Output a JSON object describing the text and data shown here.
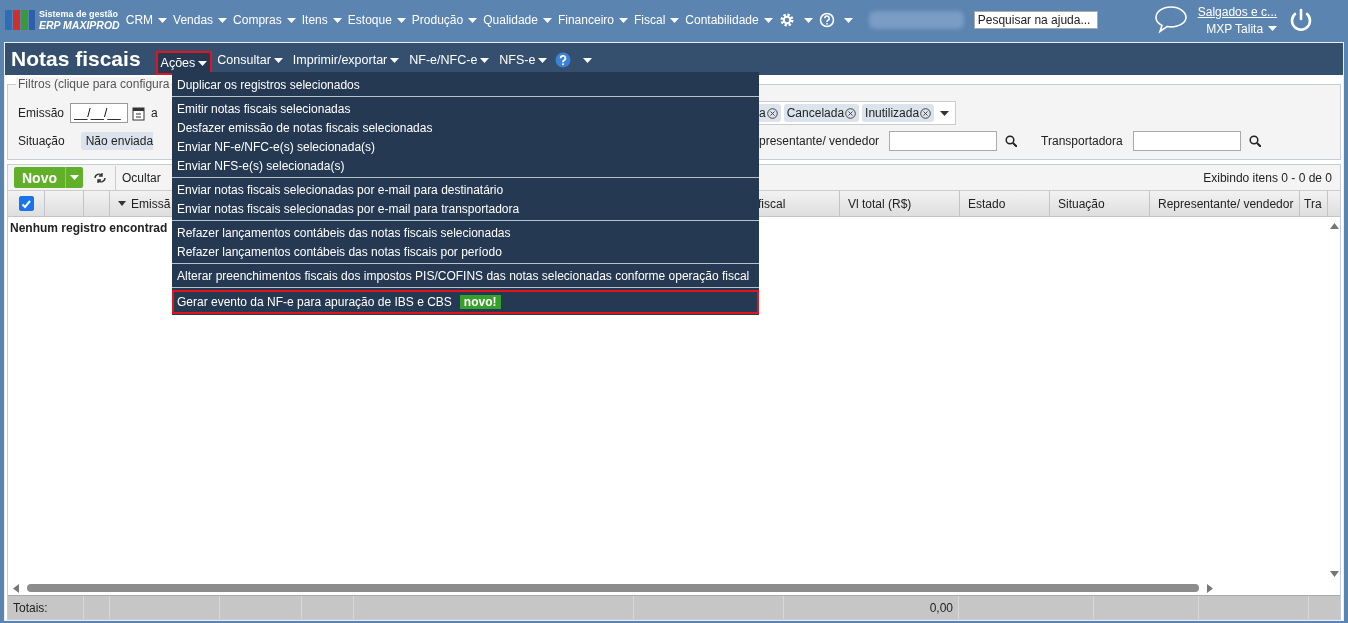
{
  "app": {
    "logo_line1": "Sistema de gestão",
    "logo_line2": "ERP MAXIPROD"
  },
  "nav": [
    {
      "label": "CRM"
    },
    {
      "label": "Vendas"
    },
    {
      "label": "Compras"
    },
    {
      "label": "Itens"
    },
    {
      "label": "Estoque"
    },
    {
      "label": "Produção"
    },
    {
      "label": "Qualidade"
    },
    {
      "label": "Financeiro"
    },
    {
      "label": "Fiscal"
    },
    {
      "label": "Contabilidade"
    }
  ],
  "help_search": {
    "placeholder": "Pesquisar na ajuda..."
  },
  "user": {
    "company": "Salgados e c...",
    "name": "MXP Talita"
  },
  "page": {
    "title": "Notas fiscais",
    "menu": [
      {
        "label": "Ações",
        "expanded": true
      },
      {
        "label": "Consultar",
        "expanded": false
      },
      {
        "label": "Imprimir/exportar",
        "expanded": false
      },
      {
        "label": "NF-e/NFC-e",
        "expanded": false
      },
      {
        "label": "NFS-e",
        "expanded": false
      }
    ]
  },
  "actions_menu": {
    "groups": [
      {
        "items": [
          {
            "label": "Duplicar os registros selecionados",
            "highlighted": false
          }
        ]
      },
      {
        "items": [
          {
            "label": "Emitir notas fiscais selecionadas",
            "highlighted": false
          },
          {
            "label": "Desfazer emissão de notas fiscais selecionadas",
            "highlighted": false
          },
          {
            "label": "Enviar NF-e/NFC-e(s) selecionada(s)",
            "highlighted": false
          },
          {
            "label": "Enviar NFS-e(s) selecionada(s)",
            "highlighted": false
          }
        ]
      },
      {
        "items": [
          {
            "label": "Enviar notas fiscais selecionadas por e-mail para destinatário",
            "highlighted": false
          },
          {
            "label": "Enviar notas fiscais selecionadas por e-mail para transportadora",
            "highlighted": false
          }
        ]
      },
      {
        "items": [
          {
            "label": "Refazer lançamentos contábeis das notas fiscais selecionadas",
            "highlighted": false
          },
          {
            "label": "Refazer lançamentos contábeis das notas fiscais por período",
            "highlighted": false
          }
        ]
      },
      {
        "items": [
          {
            "label": "Alterar preenchimentos fiscais dos impostos PIS/COFINS das notas selecionadas conforme operação fiscal",
            "highlighted": false
          }
        ]
      },
      {
        "items": [
          {
            "label": "Gerar evento da NF-e para apuração de IBS e CBS",
            "highlighted": true,
            "badge": "novo!"
          }
        ]
      }
    ]
  },
  "filters": {
    "legend": "Filtros (clique para configura",
    "emissao_label": "Emissão",
    "date_value": "__/__/__",
    "range_separator": "a",
    "situacao_label": "Situação",
    "situacao_tag": "Não enviada",
    "tags": [
      {
        "label": "a"
      },
      {
        "label": "Cancelada"
      },
      {
        "label": "Inutilizada"
      }
    ],
    "representative_label": "presentante/ vendedor",
    "carrier_label": "Transportadora"
  },
  "toolbar": {
    "new_button": "Novo",
    "hide_button": "Ocultar",
    "range_text": "Exibindo itens 0 - 0 de 0"
  },
  "table": {
    "select_all_checked": true,
    "columns": [
      {
        "label": "Emissã",
        "sorted": true
      },
      {
        "label": "fiscal",
        "sorted": false
      },
      {
        "label": "Vl total (R$)",
        "sorted": false
      },
      {
        "label": "Estado",
        "sorted": false
      },
      {
        "label": "Situação",
        "sorted": false
      },
      {
        "label": "Representante/ vendedor",
        "sorted": false
      },
      {
        "label": "Tra",
        "sorted": false
      }
    ],
    "empty_message": "Nenhum registro encontrad",
    "totals_label": "Totais:",
    "totals_value": "0,00"
  }
}
